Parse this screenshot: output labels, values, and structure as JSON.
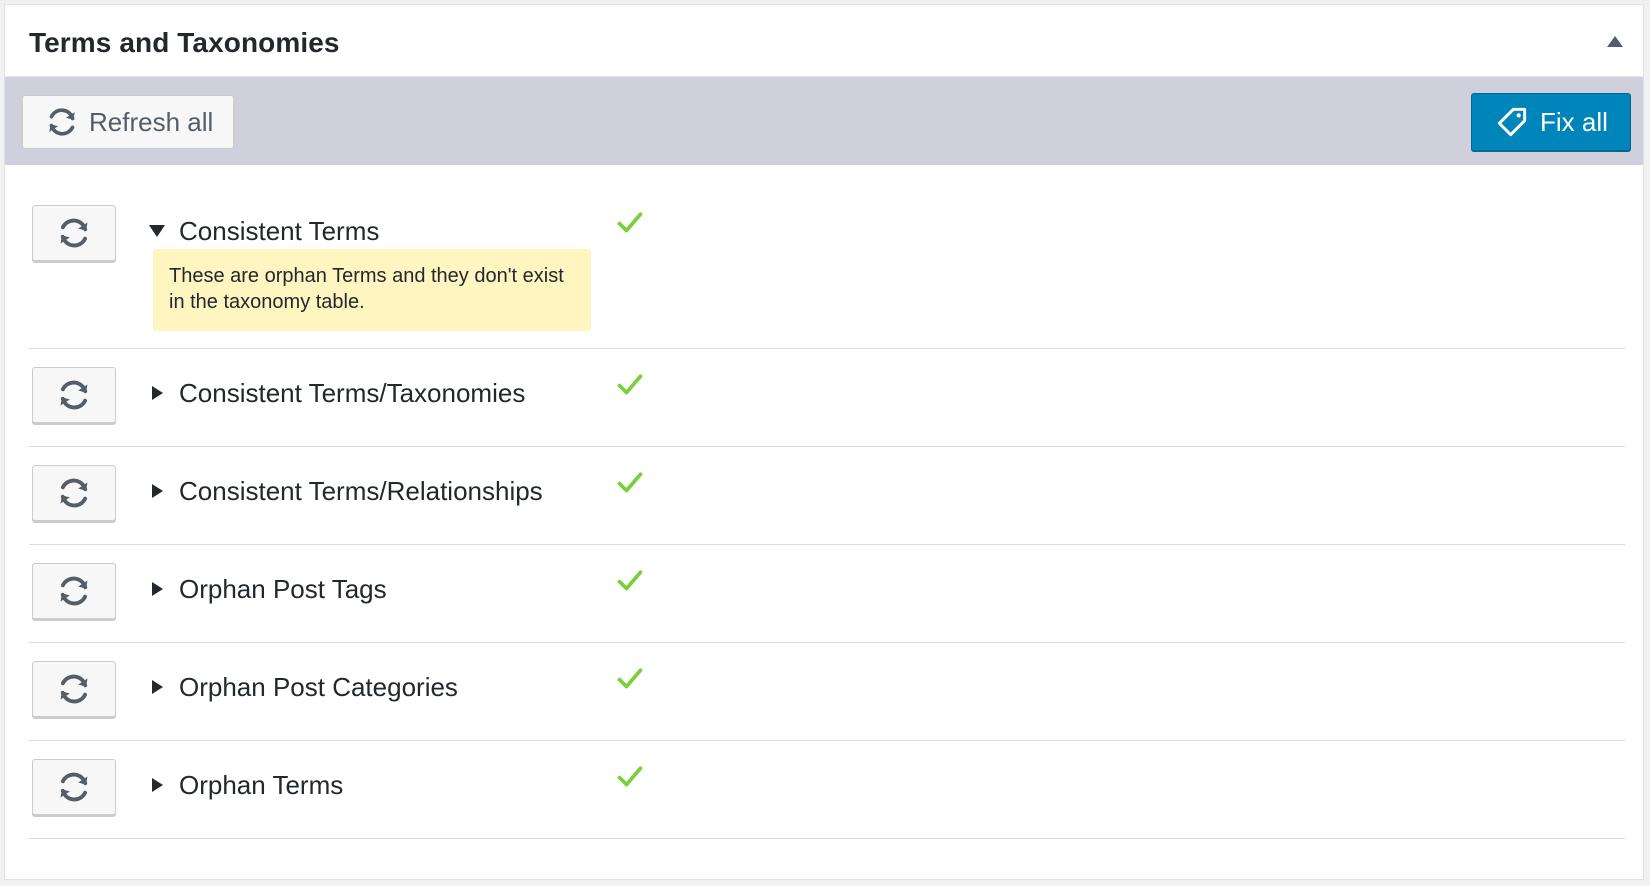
{
  "panel": {
    "title": "Terms and Taxonomies",
    "collapse_icon": "triangle-up-icon"
  },
  "toolbar": {
    "refresh_all_label": "Refresh all",
    "refresh_all_icon": "refresh-icon",
    "fix_all_label": "Fix all",
    "fix_all_icon": "tag-icon",
    "background": "#d0d0dc",
    "fix_all_color": "#0085ba"
  },
  "checks": [
    {
      "label": "Consistent Terms",
      "expanded": true,
      "status": "ok",
      "description": "These are orphan Terms and they don't exist in the taxonomy table."
    },
    {
      "label": "Consistent Terms/Taxonomies",
      "expanded": false,
      "status": "ok"
    },
    {
      "label": "Consistent Terms/Relationships",
      "expanded": false,
      "status": "ok"
    },
    {
      "label": "Orphan Post Tags",
      "expanded": false,
      "status": "ok"
    },
    {
      "label": "Orphan Post Categories",
      "expanded": false,
      "status": "ok"
    },
    {
      "label": "Orphan Terms",
      "expanded": false,
      "status": "ok"
    }
  ],
  "colors": {
    "check_ok": "#7ad03a",
    "description_bg": "#fff5c0"
  }
}
